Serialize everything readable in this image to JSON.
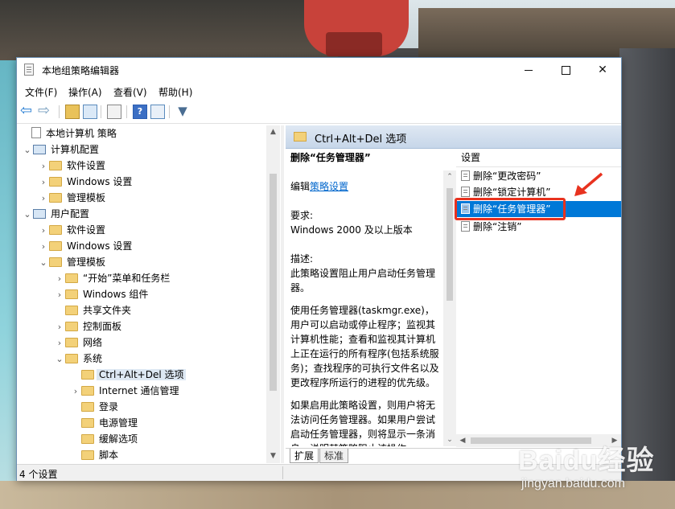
{
  "window": {
    "title": "本地组策略编辑器"
  },
  "menu": [
    "文件(F)",
    "操作(A)",
    "查看(V)",
    "帮助(H)"
  ],
  "toolbar": {
    "help_glyph": "?"
  },
  "tree": {
    "items": [
      {
        "label": "本地计算机 策略"
      },
      {
        "label": "计算机配置"
      },
      {
        "label": "软件设置"
      },
      {
        "label": "Windows 设置"
      },
      {
        "label": "管理模板"
      },
      {
        "label": "用户配置"
      },
      {
        "label": "软件设置"
      },
      {
        "label": "Windows 设置"
      },
      {
        "label": "管理模板"
      },
      {
        "label": "“开始”菜单和任务栏"
      },
      {
        "label": "Windows 组件"
      },
      {
        "label": "共享文件夹"
      },
      {
        "label": "控制面板"
      },
      {
        "label": "网络"
      },
      {
        "label": "系统"
      },
      {
        "label": "Ctrl+Alt+Del 选项"
      },
      {
        "label": "Internet 通信管理"
      },
      {
        "label": "登录"
      },
      {
        "label": "电源管理"
      },
      {
        "label": "缓解选项"
      },
      {
        "label": "脚本"
      }
    ]
  },
  "right": {
    "header": "Ctrl+Alt+Del 选项",
    "desc": {
      "title": "删除“任务管理器”",
      "edit_prefix": "编辑",
      "edit_link": "策略设置",
      "req_label": "要求:",
      "req_value": "Windows 2000 及以上版本",
      "desc_label": "描述:",
      "desc_text": "此策略设置阻止用户启动任务管理器。",
      "para1": "使用任务管理器(taskmgr.exe)，用户可以启动或停止程序；监视其计算机性能；查看和监视其计算机上正在运行的所有程序(包括系统服务)；查找程序的可执行文件名以及更改程序所运行的进程的优先级。",
      "para2": "如果启用此策略设置，则用户将无法访问任务管理器。如果用户尝试启动任务管理器，则将显示一条消息，说明某策略阻止该操作。"
    },
    "column_header": "设置",
    "settings": [
      {
        "label": "删除“更改密码”"
      },
      {
        "label": "删除“锁定计算机”"
      },
      {
        "label": "删除“任务管理器”"
      },
      {
        "label": "删除“注销”"
      }
    ],
    "tabs": [
      "扩展",
      "标准"
    ]
  },
  "status": {
    "text": "4 个设置"
  },
  "watermark": {
    "logo": "Baidu经验",
    "sub": "jingyan.baidu.com"
  }
}
